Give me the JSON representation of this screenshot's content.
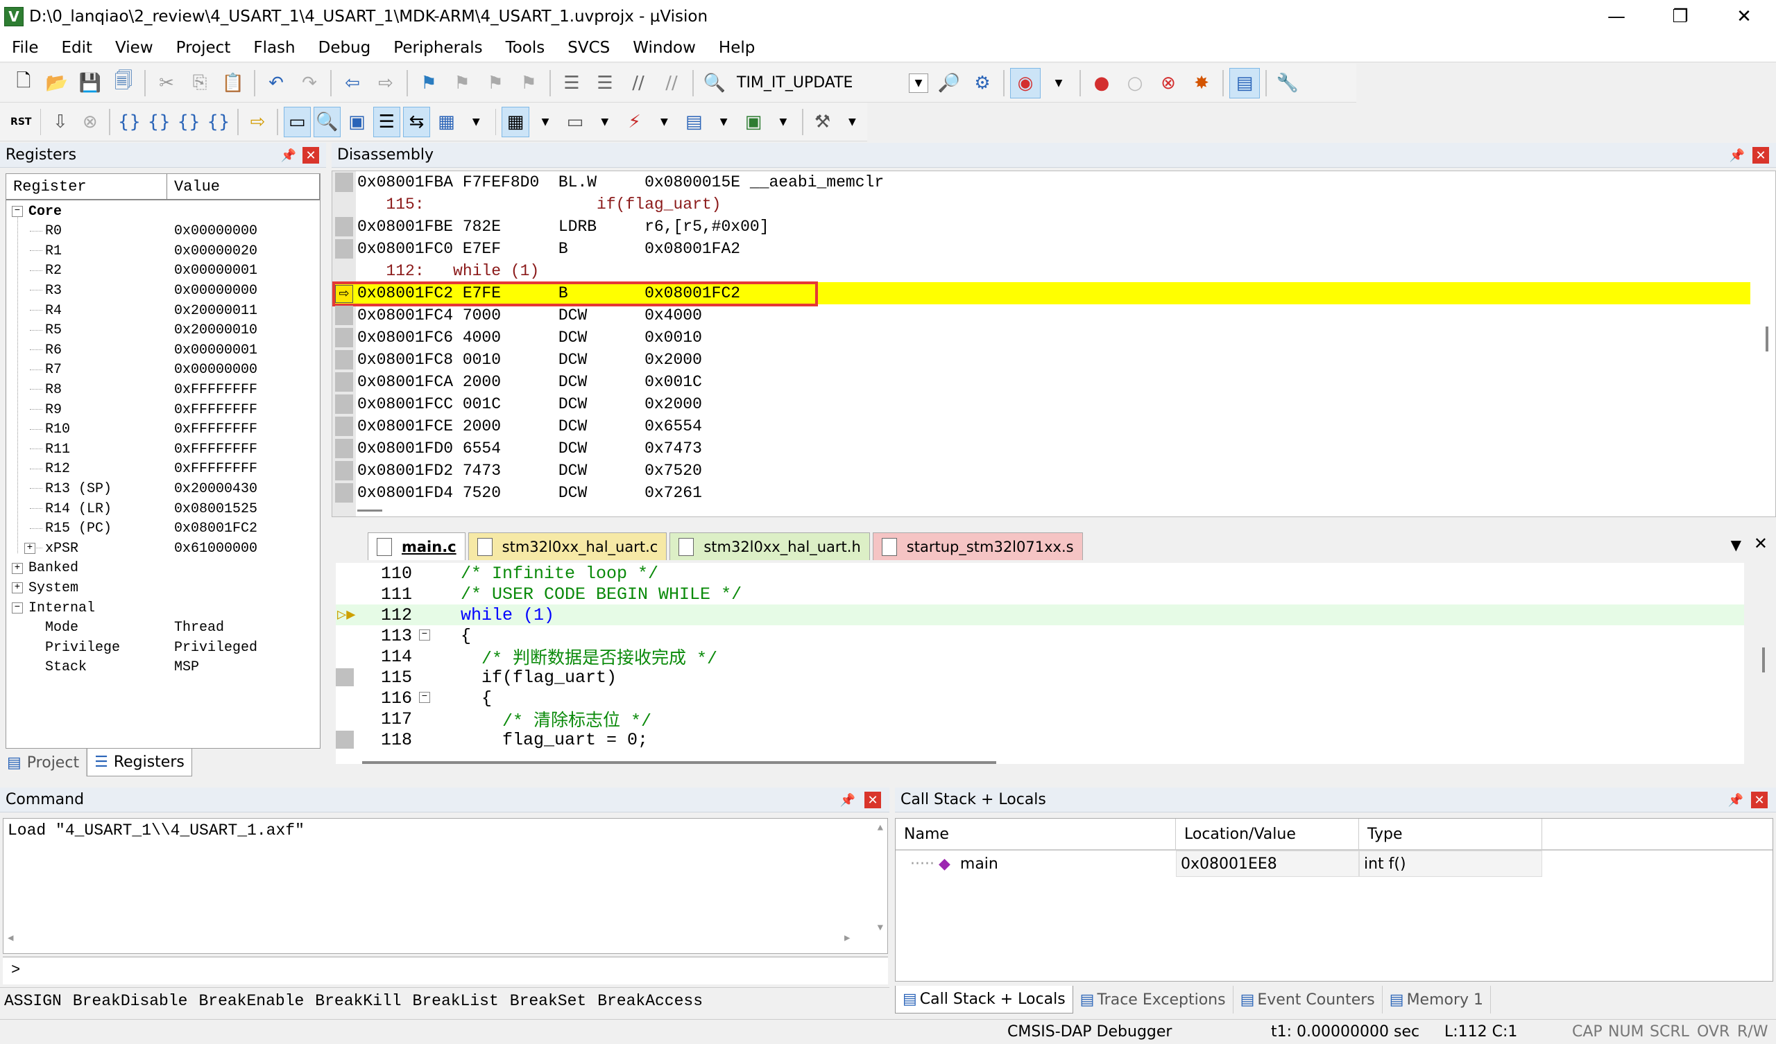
{
  "window": {
    "title": "D:\\0_lanqiao\\2_review\\4_USART_1\\4_USART_1\\MDK-ARM\\4_USART_1.uvprojx - µVision",
    "minimize": "—",
    "maximize": "❐",
    "close": "✕"
  },
  "menu": [
    "File",
    "Edit",
    "View",
    "Project",
    "Flash",
    "Debug",
    "Peripherals",
    "Tools",
    "SVCS",
    "Window",
    "Help"
  ],
  "toolbar": {
    "find_combo_value": "TIM_IT_UPDATE",
    "reset_label": "RST"
  },
  "registers_panel": {
    "title": "Registers",
    "col_register": "Register",
    "col_value": "Value",
    "core_label": "Core",
    "core": [
      {
        "name": "R0",
        "value": "0x00000000"
      },
      {
        "name": "R1",
        "value": "0x00000020"
      },
      {
        "name": "R2",
        "value": "0x00000001"
      },
      {
        "name": "R3",
        "value": "0x00000000"
      },
      {
        "name": "R4",
        "value": "0x20000011"
      },
      {
        "name": "R5",
        "value": "0x20000010"
      },
      {
        "name": "R6",
        "value": "0x00000001"
      },
      {
        "name": "R7",
        "value": "0x00000000"
      },
      {
        "name": "R8",
        "value": "0xFFFFFFFF"
      },
      {
        "name": "R9",
        "value": "0xFFFFFFFF"
      },
      {
        "name": "R10",
        "value": "0xFFFFFFFF"
      },
      {
        "name": "R11",
        "value": "0xFFFFFFFF"
      },
      {
        "name": "R12",
        "value": "0xFFFFFFFF"
      },
      {
        "name": "R13 (SP)",
        "value": "0x20000430"
      },
      {
        "name": "R14 (LR)",
        "value": "0x08001525"
      },
      {
        "name": "R15 (PC)",
        "value": "0x08001FC2"
      },
      {
        "name": "xPSR",
        "value": "0x61000000"
      }
    ],
    "groups": [
      "Banked",
      "System",
      "Internal"
    ],
    "internal": [
      {
        "name": "Mode",
        "value": "Thread"
      },
      {
        "name": "Privilege",
        "value": "Privileged"
      },
      {
        "name": "Stack",
        "value": "MSP"
      }
    ],
    "tabs": [
      "Project",
      "Registers"
    ]
  },
  "disassembly": {
    "title": "Disassembly",
    "rows": [
      {
        "text": "0x08001FBA F7FEF8D0  BL.W     0x0800015E __aeabi_memclr",
        "kind": "asm"
      },
      {
        "text": "   115:                  if(flag_uart)",
        "kind": "src"
      },
      {
        "text": "0x08001FBE 782E      LDRB     r6,[r5,#0x00]",
        "kind": "asm"
      },
      {
        "text": "0x08001FC0 E7EF      B        0x08001FA2",
        "kind": "asm"
      },
      {
        "text": "   112:   while (1)",
        "kind": "src"
      },
      {
        "text": "0x08001FC2 E7FE      B        0x08001FC2",
        "kind": "cur"
      },
      {
        "text": "0x08001FC4 7000      DCW      0x4000",
        "kind": "asm"
      },
      {
        "text": "0x08001FC6 4000      DCW      0x0010",
        "kind": "asm"
      },
      {
        "text": "0x08001FC8 0010      DCW      0x2000",
        "kind": "asm"
      },
      {
        "text": "0x08001FCA 2000      DCW      0x001C",
        "kind": "asm"
      },
      {
        "text": "0x08001FCC 001C      DCW      0x2000",
        "kind": "asm"
      },
      {
        "text": "0x08001FCE 2000      DCW      0x6554",
        "kind": "asm"
      },
      {
        "text": "0x08001FD0 6554      DCW      0x7473",
        "kind": "asm"
      },
      {
        "text": "0x08001FD2 7473      DCW      0x7520",
        "kind": "asm"
      },
      {
        "text": "0x08001FD4 7520      DCW      0x7261",
        "kind": "asm"
      }
    ]
  },
  "editor": {
    "tabs": [
      {
        "label": "main.c",
        "color": "#ffffff"
      },
      {
        "label": "stm32l0xx_hal_uart.c",
        "color": "#f6e9a6"
      },
      {
        "label": "stm32l0xx_hal_uart.h",
        "color": "#dcefc6"
      },
      {
        "label": "startup_stm32l071xx.s",
        "color": "#f5c4c4"
      }
    ],
    "lines": [
      {
        "ln": "110",
        "code": "  /* Infinite loop */"
      },
      {
        "ln": "111",
        "code": "  /* USER CODE BEGIN WHILE */"
      },
      {
        "ln": "112",
        "code": "  while (1)"
      },
      {
        "ln": "113",
        "code": "  {"
      },
      {
        "ln": "114",
        "code": "    /* 判断数据是否接收完成 */"
      },
      {
        "ln": "115",
        "code": "    if(flag_uart)"
      },
      {
        "ln": "116",
        "code": "    {"
      },
      {
        "ln": "117",
        "code": "      /* 清除标志位 */"
      },
      {
        "ln": "118",
        "code": "      flag_uart = 0;"
      }
    ]
  },
  "command": {
    "title": "Command",
    "output": "Load \"4_USART_1\\\\4_USART_1.axf\"",
    "prompt": ">",
    "hints": [
      "ASSIGN",
      "BreakDisable",
      "BreakEnable",
      "BreakKill",
      "BreakList",
      "BreakSet",
      "BreakAccess"
    ]
  },
  "callstack": {
    "title": "Call Stack + Locals",
    "col_name": "Name",
    "col_location": "Location/Value",
    "col_type": "Type",
    "row": {
      "name": "main",
      "location": "0x08001EE8",
      "type": "int f()"
    },
    "tabs": [
      "Call Stack + Locals",
      "Trace Exceptions",
      "Event Counters",
      "Memory 1"
    ]
  },
  "status": {
    "debugger": "CMSIS-DAP Debugger",
    "time": "t1: 0.00000000 sec",
    "position": "L:112 C:1",
    "caps": "CAP",
    "num": "NUM",
    "scrl": "SCRL",
    "ovr": "OVR",
    "rw": "R/W"
  },
  "colors": {
    "current_line": "#ffff00",
    "highlight_box": "#e53935",
    "source_line": "#8b1a1a",
    "comment": "#0a8a0a",
    "keyword": "#0000ff"
  }
}
